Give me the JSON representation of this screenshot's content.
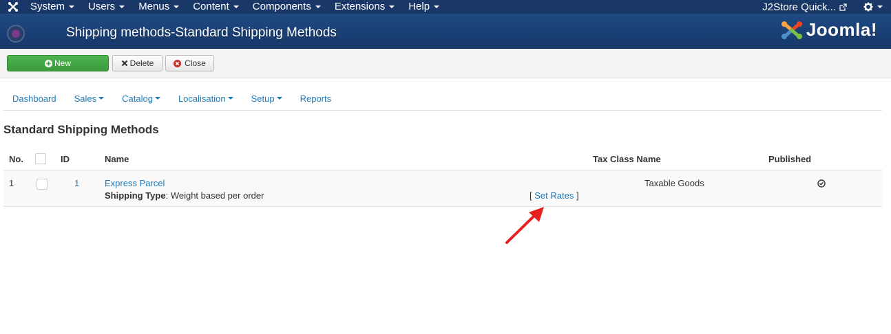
{
  "topbar": {
    "menus": [
      "System",
      "Users",
      "Menus",
      "Content",
      "Components",
      "Extensions",
      "Help"
    ],
    "quick_link": "J2Store Quick..."
  },
  "header": {
    "title": "Shipping methods-Standard Shipping Methods",
    "brand": "Joomla!"
  },
  "toolbar": {
    "new_label": "New",
    "delete_label": "Delete",
    "close_label": "Close"
  },
  "submenu": {
    "items": [
      {
        "label": "Dashboard",
        "dropdown": false
      },
      {
        "label": "Sales",
        "dropdown": true
      },
      {
        "label": "Catalog",
        "dropdown": true
      },
      {
        "label": "Localisation",
        "dropdown": true
      },
      {
        "label": "Setup",
        "dropdown": true
      },
      {
        "label": "Reports",
        "dropdown": false
      }
    ]
  },
  "section_title": "Standard Shipping Methods",
  "table": {
    "headers": {
      "no": "No.",
      "id": "ID",
      "name": "Name",
      "tax_class": "Tax Class Name",
      "published": "Published"
    },
    "rows": [
      {
        "no": "1",
        "id": "1",
        "name": "Express Parcel",
        "shipping_type_label": "Shipping Type",
        "shipping_type_value": ": Weight based per order",
        "bracket_open": "[",
        "set_rates": "Set Rates",
        "bracket_close": "]",
        "tax_class": "Taxable Goods",
        "published": true
      }
    ]
  },
  "colors": {
    "topbar": "#1a3867",
    "header": "#1f4a84",
    "new_button": "#46a546",
    "link": "#1f79b8",
    "annotation_arrow": "#e8201f"
  }
}
